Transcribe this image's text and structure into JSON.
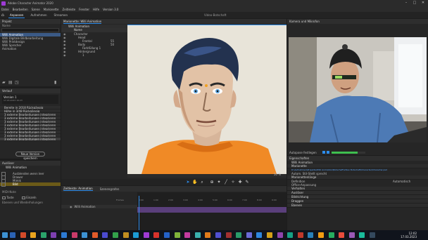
{
  "window": {
    "title": "Adobe Character Animator 2020",
    "min": "–",
    "max": "□",
    "close": "✕"
  },
  "menu": [
    "Datei",
    "Bearbeiten",
    "Szene",
    "Marionette",
    "Zeitleiste",
    "Fenster",
    "Hilfe",
    "Version 3.0"
  ],
  "modes": {
    "home": "⌂",
    "tabs": [
      "Anpassen",
      "Aufnehmen",
      "Streamen"
    ],
    "active": 0,
    "center_title": "Video-Botschaft"
  },
  "projekt": {
    "title": "Projekt",
    "column": "Name",
    "items": [
      {
        "label": "Willi Animation",
        "selected": true
      },
      {
        "label": "Willi Digitale Bildbearbeitung",
        "selected": false
      },
      {
        "label": "Willi Printdesign",
        "selected": false
      },
      {
        "label": "Willi Sprecher",
        "selected": false
      },
      {
        "label": "Animation",
        "selected": false
      }
    ]
  },
  "verlauf": {
    "title": "Verlauf",
    "version_name": "Version 1",
    "version_date": "17.03.2023 16:23",
    "rows": [
      "Bereite in 2018 Rückgängig",
      "Höhe in 3/48 Rückgängig",
      "3 externe Bearbeitungen integrieren",
      "3 externe Bearbeitungen integrieren",
      "3 externe Bearbeitungen integrieren",
      "3 externe Bearbeitungen integrieren",
      "3 externe Bearbeitungen integrieren",
      "3 externe Bearbeitungen integrieren",
      "3 externe Bearbeitungen integrieren",
      "3 externe Bearbeitungen integrieren"
    ],
    "save_button": "Neue Version speichern"
  },
  "ausloeser": {
    "title": "Auslöser",
    "puppet": "Willi Animation",
    "items": [
      {
        "label": "Ausblenden wenn leer",
        "selected": false
      },
      {
        "label": "Drawer",
        "selected": false
      },
      {
        "label": "Mimik",
        "selected": false
      },
      {
        "label": "Bild",
        "selected": true
      }
    ],
    "midi_label": "MIDI-Note",
    "key_label": "Taste",
    "stack_label": "Einzeln",
    "footer": "Ebenen und Wiederholungen"
  },
  "puppen": {
    "tab": "Marionette: Willi Animation",
    "puppet_name": "Willi Animation",
    "tree_header": "Name",
    "layers": [
      "Character",
      "Head",
      "Frontal",
      "Body",
      "Farbfüllung 1",
      "Hintergrund",
      "1"
    ],
    "layer_values": [
      "",
      "",
      "55",
      "50",
      "",
      "",
      ""
    ],
    "zoom": "50 %"
  },
  "timeline": {
    "tabs": [
      "Zeitleiste: Animation",
      "Szenengrafen"
    ],
    "track_name": "Willi Animation",
    "ruler_labels": [
      "Frames",
      "0:00",
      "1:00",
      "2:00",
      "3:00",
      "4:00",
      "5:00",
      "6:00",
      "7:00",
      "8:00",
      "9:00"
    ]
  },
  "kamera": {
    "title": "Kamera und Mikrofon",
    "autopose": "Autopose festlegen",
    "mic_level": 0.78
  },
  "eigenschaften": {
    "title": "Eigenschaften",
    "puppet": "Willi Animation",
    "section1": "Marionette",
    "path": "D:\\Aufnahmen\\Projekte\\Willi Animation\\Botschaft\\Video Botschaft\\Character\\Character.psd",
    "auto_swap": "Autom. Stil-Stellt sprecht",
    "section2": "Marionettenlänge",
    "row_a_label": "Definition",
    "row_a_value": "Automatisch",
    "row_b_label": "Office-Anpassung",
    "groups": [
      "Verhalten",
      "Auslöser",
      "Bildrichtung",
      "Draggen",
      "Ebenen"
    ]
  },
  "taskbar": {
    "time": "12:02",
    "date": "17.03.2023",
    "icon_colors": [
      "#2a62b5",
      "#d04a2a",
      "#e7a21f",
      "#2aa26c",
      "#7b3fb2",
      "#2c7ad6",
      "#c83a6a",
      "#3c91d5",
      "#e05a2a",
      "#4b4bd1",
      "#32a04b",
      "#bf8d21",
      "#1c9bd6",
      "#9f3bd6",
      "#d6322c",
      "#2462c9",
      "#7fb23a",
      "#c23aa0",
      "#3ab0b0",
      "#e07a1a",
      "#5050d0",
      "#a03030",
      "#2a9a6a",
      "#6a6ad6",
      "#2e86de",
      "#d4a017",
      "#8e44ad",
      "#16a085",
      "#c0392b",
      "#2980b9",
      "#f39c12",
      "#27ae60",
      "#e74c3c",
      "#9b59b6",
      "#1abc9c",
      "#34495e"
    ]
  }
}
